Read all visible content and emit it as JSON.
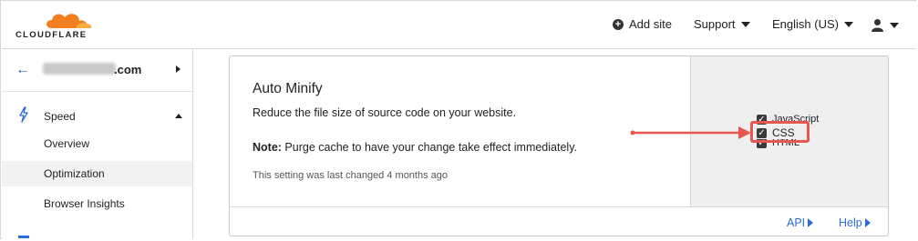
{
  "header": {
    "logo_text": "CLOUDFLARE",
    "add_site": "Add site",
    "support": "Support",
    "language": "English (US)",
    "colors": {
      "brand_orange": "#f38020",
      "accent_blue": "#2c6cd3"
    }
  },
  "sidebar": {
    "site_tld": ".com",
    "section": "Speed",
    "items": [
      {
        "label": "Overview"
      },
      {
        "label": "Optimization"
      },
      {
        "label": "Browser Insights"
      }
    ],
    "active_item": "Optimization"
  },
  "card": {
    "title": "Auto Minify",
    "description": "Reduce the file size of source code on your website.",
    "note_label": "Note:",
    "note_text": " Purge cache to have your change take effect immediately.",
    "last_changed": "This setting was last changed 4 months ago",
    "options": [
      {
        "label": "JavaScript",
        "checked": true
      },
      {
        "label": "CSS",
        "checked": true
      },
      {
        "label": "HTML",
        "checked": true
      }
    ],
    "highlight_color": "#e8574d",
    "footer": {
      "api_label": "API",
      "help_label": "Help"
    }
  }
}
